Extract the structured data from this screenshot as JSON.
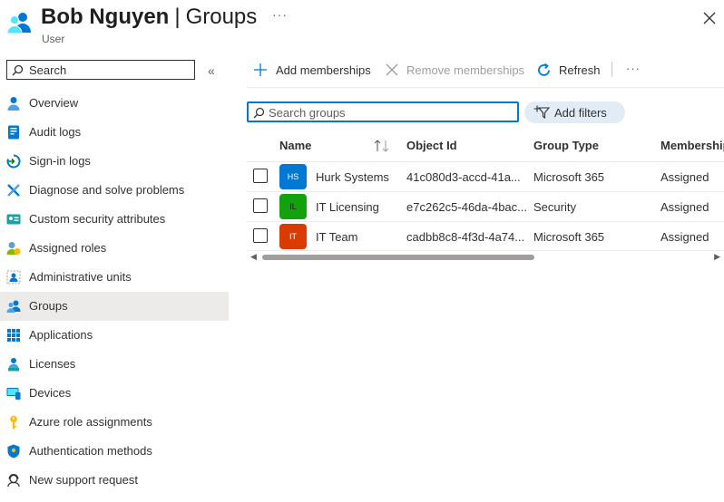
{
  "header": {
    "name": "Bob Nguyen",
    "separator": "|",
    "section": "Groups",
    "subtitle": "User",
    "more": "···",
    "icon": "users-icon"
  },
  "sidebar": {
    "search_placeholder": "Search",
    "collapse": "«",
    "items": [
      {
        "label": "Overview",
        "icon": "person-icon"
      },
      {
        "label": "Audit logs",
        "icon": "audit-log-icon"
      },
      {
        "label": "Sign-in logs",
        "icon": "sign-in-icon"
      },
      {
        "label": "Diagnose and solve problems",
        "icon": "wrench-icon"
      },
      {
        "label": "Custom security attributes",
        "icon": "security-attributes-icon"
      },
      {
        "label": "Assigned roles",
        "icon": "roles-icon"
      },
      {
        "label": "Administrative units",
        "icon": "admin-units-icon"
      },
      {
        "label": "Groups",
        "icon": "groups-icon",
        "active": true
      },
      {
        "label": "Applications",
        "icon": "applications-grid-icon"
      },
      {
        "label": "Licenses",
        "icon": "license-icon"
      },
      {
        "label": "Devices",
        "icon": "device-icon"
      },
      {
        "label": "Azure role assignments",
        "icon": "key-icon"
      },
      {
        "label": "Authentication methods",
        "icon": "shield-icon"
      },
      {
        "label": "New support request",
        "icon": "support-icon"
      }
    ]
  },
  "toolbar": {
    "add_memberships": "Add memberships",
    "remove_memberships": "Remove memberships",
    "refresh": "Refresh",
    "more": "···"
  },
  "filters": {
    "search_placeholder": "Search groups",
    "add_filters": "Add filters"
  },
  "table": {
    "columns": [
      "Name",
      "Object Id",
      "Group Type",
      "Membership"
    ],
    "rows": [
      {
        "initials": "HS",
        "color": "#0078d4",
        "name": "Hurk Systems",
        "object_id": "41c080d3-accd-41a...",
        "group_type": "Microsoft 365",
        "membership": "Assigned"
      },
      {
        "initials": "IL",
        "color": "#13a10e",
        "name": "IT Licensing",
        "object_id": "e7c262c5-46da-4bac...",
        "group_type": "Security",
        "membership": "Assigned"
      },
      {
        "initials": "IT",
        "color": "#da3b01",
        "name": "IT Team",
        "object_id": "cadbb8c8-4f3d-4a74...",
        "group_type": "Microsoft 365",
        "membership": "Assigned"
      }
    ]
  },
  "colors": {
    "accent": "#0078d4",
    "active_nav": "#edebe9"
  }
}
